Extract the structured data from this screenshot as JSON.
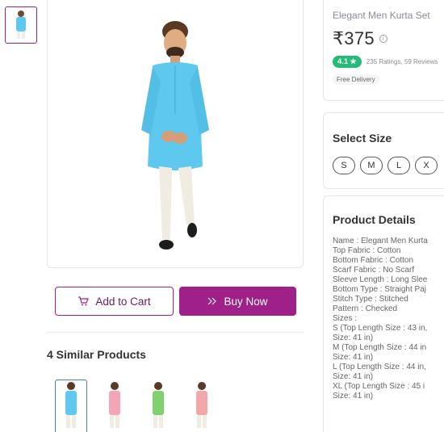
{
  "product": {
    "title": "Elegant Men Kurta Set",
    "price": "₹375",
    "rating": "4.1",
    "rating_star": "★",
    "ratings_text": "235 Ratings, 59 Reviews",
    "free_delivery": "Free Delivery"
  },
  "colors": {
    "accent": "#9f2089",
    "rating_green": "#23bb75",
    "kurta_blue": "#5ec8ee"
  },
  "actions": {
    "add_to_cart": "Add to Cart",
    "buy_now": "Buy Now",
    "cart_icon": "cart-icon",
    "buy_icon": "double-chevron-right-icon"
  },
  "size": {
    "title": "Select Size",
    "options": [
      "S",
      "M",
      "L",
      "X"
    ]
  },
  "similar": {
    "title": "4 Similar Products",
    "items": [
      {
        "color": "#5ec8ee"
      },
      {
        "color": "#f4a6b8"
      },
      {
        "color": "#7ed36f"
      },
      {
        "color": "#f2a8a8"
      }
    ]
  },
  "details": {
    "title": "Product Details",
    "lines": [
      "Name : Elegant Men Kurta",
      "Top Fabric : Cotton",
      "Bottom Fabric : Cotton",
      "Scarf Fabric : No Scarf",
      "Sleeve Length : Long Slee",
      "Bottom Type : Straight Paj",
      "Stitch Type : Stitched",
      "Pattern : Checked",
      "Sizes :",
      "S (Top Length Size : 43 in,",
      "Size: 41 in)",
      "M (Top Length Size : 44 in",
      "Size: 41 in)",
      "L (Top Length Size : 44 in,",
      "Size: 41 in)",
      "XL (Top Length Size : 45 i",
      "Size: 41 in)"
    ]
  }
}
